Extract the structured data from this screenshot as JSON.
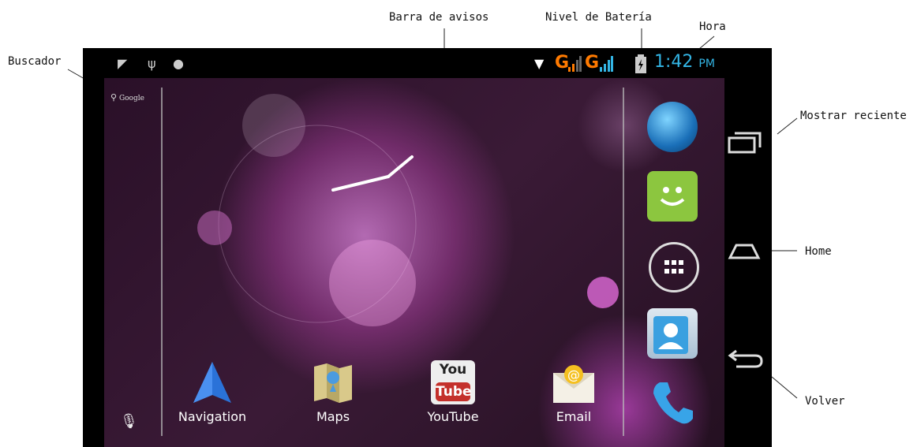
{
  "callouts": {
    "buscador": "Buscador",
    "barra_avisos": "Barra de avisos",
    "nivel_bateria": "Nivel de Batería",
    "hora": "Hora",
    "mostrar_reciente": "Mostrar reciente",
    "home": "Home",
    "volver": "Volver"
  },
  "status_bar": {
    "time": "1:42",
    "ampm": "PM",
    "network1": "G",
    "network2": "G"
  },
  "search": {
    "label": "Google"
  },
  "apps": [
    {
      "label": "Navigation"
    },
    {
      "label": "Maps"
    },
    {
      "label": "YouTube"
    },
    {
      "label": "Email"
    }
  ],
  "youtube_logo": {
    "top": "You",
    "bottom": "Tube"
  },
  "colors": {
    "clock": "#33b5e5",
    "signal": "#ff7a00",
    "sms_green": "#8cc63f"
  }
}
